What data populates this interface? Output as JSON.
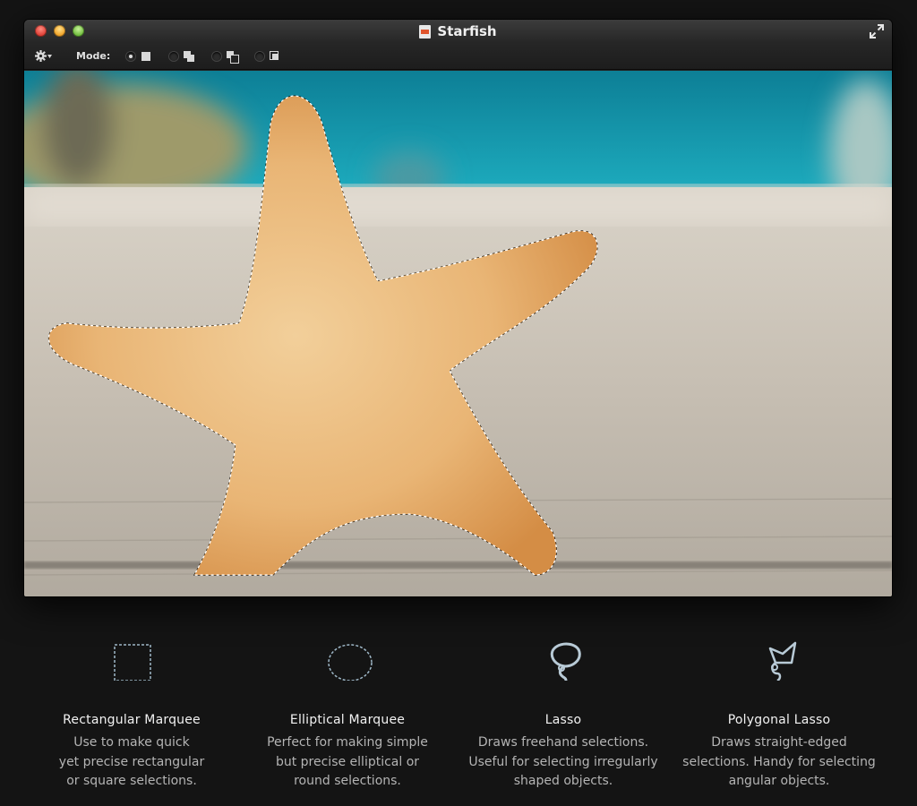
{
  "window": {
    "title": "Starfish",
    "icons": {
      "close": "close-button",
      "minimize": "minimize-button",
      "zoom": "zoom-button",
      "fullscreen": "fullscreen-arrows-icon",
      "document": "document-icon"
    }
  },
  "toolbar": {
    "gear_icon": "gear-icon",
    "mode_label": "Mode:",
    "modes": [
      {
        "id": "new",
        "icon": "new-selection-icon",
        "selected": true
      },
      {
        "id": "add",
        "icon": "add-selection-icon",
        "selected": false
      },
      {
        "id": "subtract",
        "icon": "subtract-selection-icon",
        "selected": false
      },
      {
        "id": "intersect",
        "icon": "intersect-selection-icon",
        "selected": false
      }
    ]
  },
  "image": {
    "subject": "starfish",
    "selection": "marching-ants"
  },
  "tools": [
    {
      "name": "Rectangular Marquee",
      "icon": "rectangular-marquee-icon",
      "desc": [
        "Use to make quick",
        "yet precise rectangular",
        "or square selections."
      ]
    },
    {
      "name": "Elliptical Marquee",
      "icon": "elliptical-marquee-icon",
      "desc": [
        "Perfect for making simple",
        "but precise elliptical or",
        "round selections."
      ]
    },
    {
      "name": "Lasso",
      "icon": "lasso-icon",
      "desc": [
        "Draws freehand selections.",
        "Useful for selecting irregularly",
        "shaped objects."
      ]
    },
    {
      "name": "Polygonal Lasso",
      "icon": "polygonal-lasso-icon",
      "desc": [
        "Draws straight-edged",
        "selections. Handy for selecting",
        "angular objects."
      ]
    }
  ],
  "colors": {
    "background": "#141414",
    "window": "#222222",
    "sky": "#1ea3b8",
    "sand": "#c9c2b6",
    "starfish": "#eab87a"
  }
}
